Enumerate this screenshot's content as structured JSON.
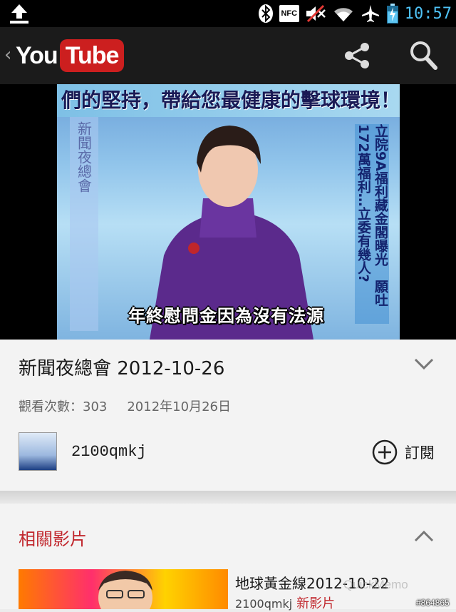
{
  "status_bar": {
    "time": "10:57",
    "nfc_label": "NFC",
    "icons": [
      "upload-icon",
      "bluetooth-icon",
      "nfc-icon",
      "volume-muted-icon",
      "wifi-icon",
      "airplane-icon",
      "battery-icon"
    ],
    "time_color": "#4fc3f7"
  },
  "app_bar": {
    "logo_you": "You",
    "logo_tube": "Tube",
    "brand_color": "#cc1f1f"
  },
  "video": {
    "ticker_text": "們的堅持，帶給您最健康的擊球環境！歡迎",
    "left_strip_text": "新聞夜總會",
    "right_strip_text": "立院9A福利藏金閣曝光　願吐172萬福利…立委有幾人?",
    "subtitle_text": "年終慰問金因為沒有法源"
  },
  "info": {
    "title": "新聞夜總會 2012-10-26",
    "views": "觀看次數：303",
    "date": "2012年10月26日",
    "channel_name": "2100qmkj",
    "subscribe_label": "訂閱"
  },
  "related": {
    "heading": "相關影片",
    "accent_color": "#c1272d",
    "items": [
      {
        "title": "地球黃金線2012-10-22",
        "channel": "2100qmkj",
        "badge": "新影片"
      }
    ]
  },
  "watermarks": {
    "quickmemo": "QuickMemo",
    "id": "#864865"
  }
}
